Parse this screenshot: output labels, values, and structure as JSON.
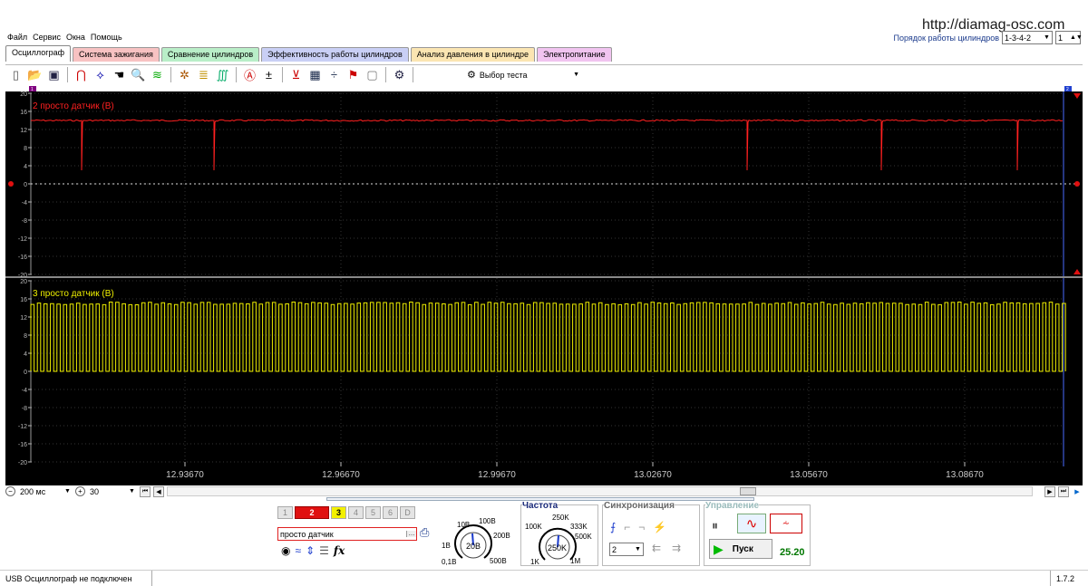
{
  "site_url": "http://diamag-osc.com",
  "menu": [
    "Файл",
    "Сервис",
    "Окна",
    "Помощь"
  ],
  "fire_order": {
    "label": "Порядок работы цилиндров",
    "value": "1-3-4-2",
    "cyl_value": "1"
  },
  "tabs": [
    {
      "label": "Осциллограф",
      "color": "#ffffff",
      "active": true
    },
    {
      "label": "Система зажигания",
      "color": "#f7c2c2"
    },
    {
      "label": "Сравнение цилиндров",
      "color": "#b9eec8"
    },
    {
      "label": "Эффективность работы цилиндров",
      "color": "#c9cff5"
    },
    {
      "label": "Анализ давления в цилиндре",
      "color": "#fbe5b2"
    },
    {
      "label": "Электропитание",
      "color": "#f1c4f0"
    }
  ],
  "toolbar": {
    "test_select_label": "Выбор теста"
  },
  "scope": {
    "channels": [
      {
        "label": "2 просто датчик (В)",
        "color": "#ff2020",
        "level_v": 14,
        "spike_low_v": 3,
        "ylim": [
          -20,
          20
        ]
      },
      {
        "label": "3 просто датчик (В)",
        "color": "#f0f000",
        "high_v": 15,
        "low_v": 0,
        "ylim": [
          -20,
          20
        ]
      }
    ],
    "y_ticks": [
      "20",
      "16",
      "12",
      "8",
      "4",
      "0",
      "-4",
      "-8",
      "-12",
      "-16",
      "-20"
    ],
    "x_ticks": [
      "12.93670",
      "12.96670",
      "12.99670",
      "13.02670",
      "13.05670",
      "13.08670"
    ],
    "marker_left": "1",
    "marker_right": "2"
  },
  "bottom_nav": {
    "timebase": "200 мс",
    "count": "30"
  },
  "channels_panel": {
    "buttons": [
      "1",
      "2",
      "3",
      "4",
      "5",
      "6",
      "D"
    ],
    "sensor_name": "просто датчик",
    "fx_label": "fx"
  },
  "voltage_knob": {
    "value": "20В",
    "marks": [
      "10В",
      "100В",
      "200В",
      "500В",
      "0,1В",
      "1В"
    ]
  },
  "frequency": {
    "title": "Частота",
    "value": "250K",
    "marks": [
      "250K",
      "100K",
      "333K",
      "500K",
      "1M",
      "1K"
    ]
  },
  "sync": {
    "title": "Синхронизация",
    "channel": "2"
  },
  "control": {
    "title": "Управление",
    "start_label": "Пуск",
    "rate": "25.20"
  },
  "status": {
    "message": "USB Осциллограф не подключен",
    "version": "1.7.2"
  }
}
